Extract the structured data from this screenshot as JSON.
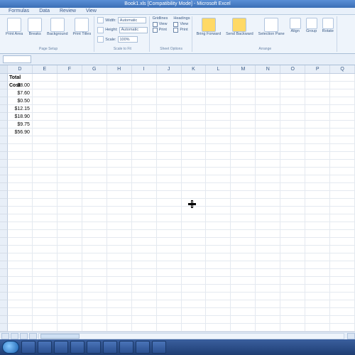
{
  "title": "Book1.xls [Compatibility Mode] - Microsoft Excel",
  "tabs": [
    "Formulas",
    "Data",
    "Review",
    "View"
  ],
  "ribbon": {
    "print": {
      "print_area": "Print\nArea",
      "breaks": "Breaks",
      "background": "Background",
      "print_titles": "Print\nTitles",
      "group_label": "Page Setup"
    },
    "scale": {
      "width": "Width:",
      "width_val": "Automatic",
      "height": "Height:",
      "height_val": "Automatic",
      "scale": "Scale:",
      "scale_val": "100%",
      "group_label": "Scale to Fit"
    },
    "sheetopts": {
      "gridlines": "Gridlines",
      "headings": "Headings",
      "view": "View",
      "print": "Print",
      "group_label": "Sheet Options"
    },
    "arrange": {
      "bring": "Bring\nForward",
      "send": "Send\nBackward",
      "selection": "Selection\nPane",
      "align": "Align",
      "group": "Group",
      "rotate": "Rotate",
      "group_label": "Arrange"
    }
  },
  "columns": [
    "D",
    "E",
    "F",
    "G",
    "H",
    "I",
    "J",
    "K",
    "L",
    "M",
    "N",
    "O",
    "P",
    "Q"
  ],
  "data_cells": {
    "header": "Total Cost",
    "values": [
      "$8.00",
      "$7.60",
      "$0.50",
      "$12.15",
      "$18.90",
      "$9.75",
      "$56.90"
    ]
  },
  "taskbar_items": 9
}
